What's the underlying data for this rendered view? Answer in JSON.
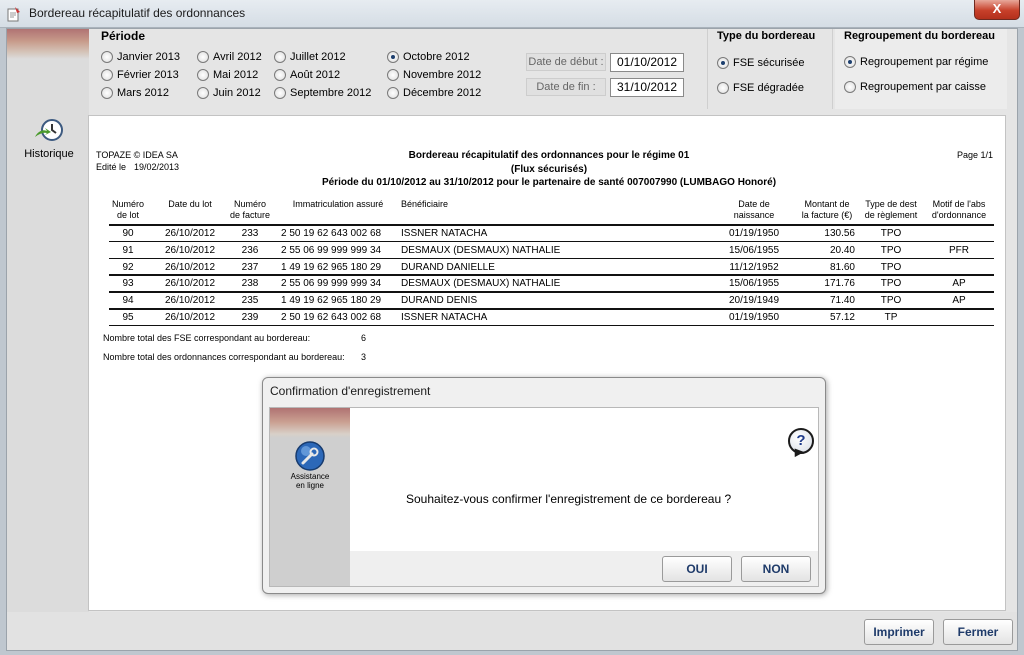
{
  "window": {
    "title": "Bordereau récapitulatif des ordonnances",
    "close_label": "X"
  },
  "sidebar": {
    "historique_label": "Historique"
  },
  "periode": {
    "title": "Période",
    "selected": "Octobre 2012",
    "options": [
      "Janvier 2013",
      "Février 2013",
      "Mars 2012",
      "Avril 2012",
      "Mai 2012",
      "Juin 2012",
      "Juillet 2012",
      "Août 2012",
      "Septembre 2012",
      "Octobre 2012",
      "Novembre 2012",
      "Décembre 2012"
    ]
  },
  "dates": {
    "debut_label": "Date de début :",
    "debut_value": "01/10/2012",
    "fin_label": "Date de fin :",
    "fin_value": "31/10/2012"
  },
  "type_bordereau": {
    "title": "Type du bordereau",
    "options": [
      "FSE sécurisée",
      "FSE dégradée"
    ],
    "selected": "FSE sécurisée"
  },
  "regroupement": {
    "title": "Regroupement du bordereau",
    "options": [
      "Regroupement par régime",
      "Regroupement par caisse"
    ],
    "selected": "Regroupement par régime"
  },
  "report": {
    "company": "TOPAZE © IDEA SA",
    "edite_label": "Edité le",
    "edite_date": "19/02/2013",
    "page": "Page 1/1",
    "title": "Bordereau récapitulatif des ordonnances pour le régime 01",
    "subtitle": "(Flux sécurisés)",
    "periode_line": "Période du 01/10/2012 au 31/10/2012 pour le partenaire de santé 007007990 (LUMBAGO Honoré)",
    "headers": {
      "lot_1": "Numéro",
      "lot_2": "de lot",
      "date_lot": "Date du lot",
      "facture_1": "Numéro",
      "facture_2": "de facture",
      "immat": "Immatriculation assuré",
      "benef": "Bénéficiaire",
      "naiss_1": "Date de",
      "naiss_2": "naissance",
      "montant_1": "Montant de",
      "montant_2": "la facture (€)",
      "type_1": "Type de dest",
      "type_2": "de règlement",
      "motif_1": "Motif de l'abs",
      "motif_2": "d'ordonnance"
    },
    "rows": [
      {
        "lot": "90",
        "date": "26/10/2012",
        "facture": "233",
        "immat": "2 50 19 62 643 002 68",
        "benef": "ISSNER NATACHA",
        "naissance": "01/19/1950",
        "montant": "130.56",
        "type": "TPO",
        "motif": ""
      },
      {
        "lot": "91",
        "date": "26/10/2012",
        "facture": "236",
        "immat": "2 55 06 99 999 999 34",
        "benef": "DESMAUX (DESMAUX) NATHALIE",
        "naissance": "15/06/1955",
        "montant": "20.40",
        "type": "TPO",
        "motif": "PFR"
      },
      {
        "lot": "92",
        "date": "26/10/2012",
        "facture": "237",
        "immat": "1 49 19 62 965 180 29",
        "benef": "DURAND DANIELLE",
        "naissance": "11/12/1952",
        "montant": "81.60",
        "type": "TPO",
        "motif": ""
      },
      {
        "lot": "93",
        "date": "26/10/2012",
        "facture": "238",
        "immat": "2 55 06 99 999 999 34",
        "benef": "DESMAUX (DESMAUX) NATHALIE",
        "naissance": "15/06/1955",
        "montant": "171.76",
        "type": "TPO",
        "motif": "AP"
      },
      {
        "lot": "94",
        "date": "26/10/2012",
        "facture": "235",
        "immat": "1 49 19 62 965 180 29",
        "benef": "DURAND DENIS",
        "naissance": "20/19/1949",
        "montant": "71.40",
        "type": "TPO",
        "motif": "AP"
      },
      {
        "lot": "95",
        "date": "26/10/2012",
        "facture": "239",
        "immat": "2 50 19 62 643 002 68",
        "benef": "ISSNER NATACHA",
        "naissance": "01/19/1950",
        "montant": "57.12",
        "type": "TP",
        "motif": ""
      }
    ],
    "total_fse_label": "Nombre total des FSE correspondant au bordereau:",
    "total_fse_value": "6",
    "total_ord_label": "Nombre total des ordonnances correspondant au bordereau:",
    "total_ord_value": "3"
  },
  "buttons": {
    "imprimer": "Imprimer",
    "fermer": "Fermer"
  },
  "dialog": {
    "title": "Confirmation d'enregistrement",
    "assist_label_1": "Assistance",
    "assist_label_2": "en ligne",
    "question_icon": "?",
    "message": "Souhaitez-vous confirmer l'enregistrement de ce bordereau ?",
    "oui": "OUI",
    "non": "NON"
  },
  "icons": {
    "app": "document-icon",
    "historique": "clock-arrow-icon",
    "assistance": "wrench-globe-icon",
    "question": "question-bubble-icon"
  }
}
